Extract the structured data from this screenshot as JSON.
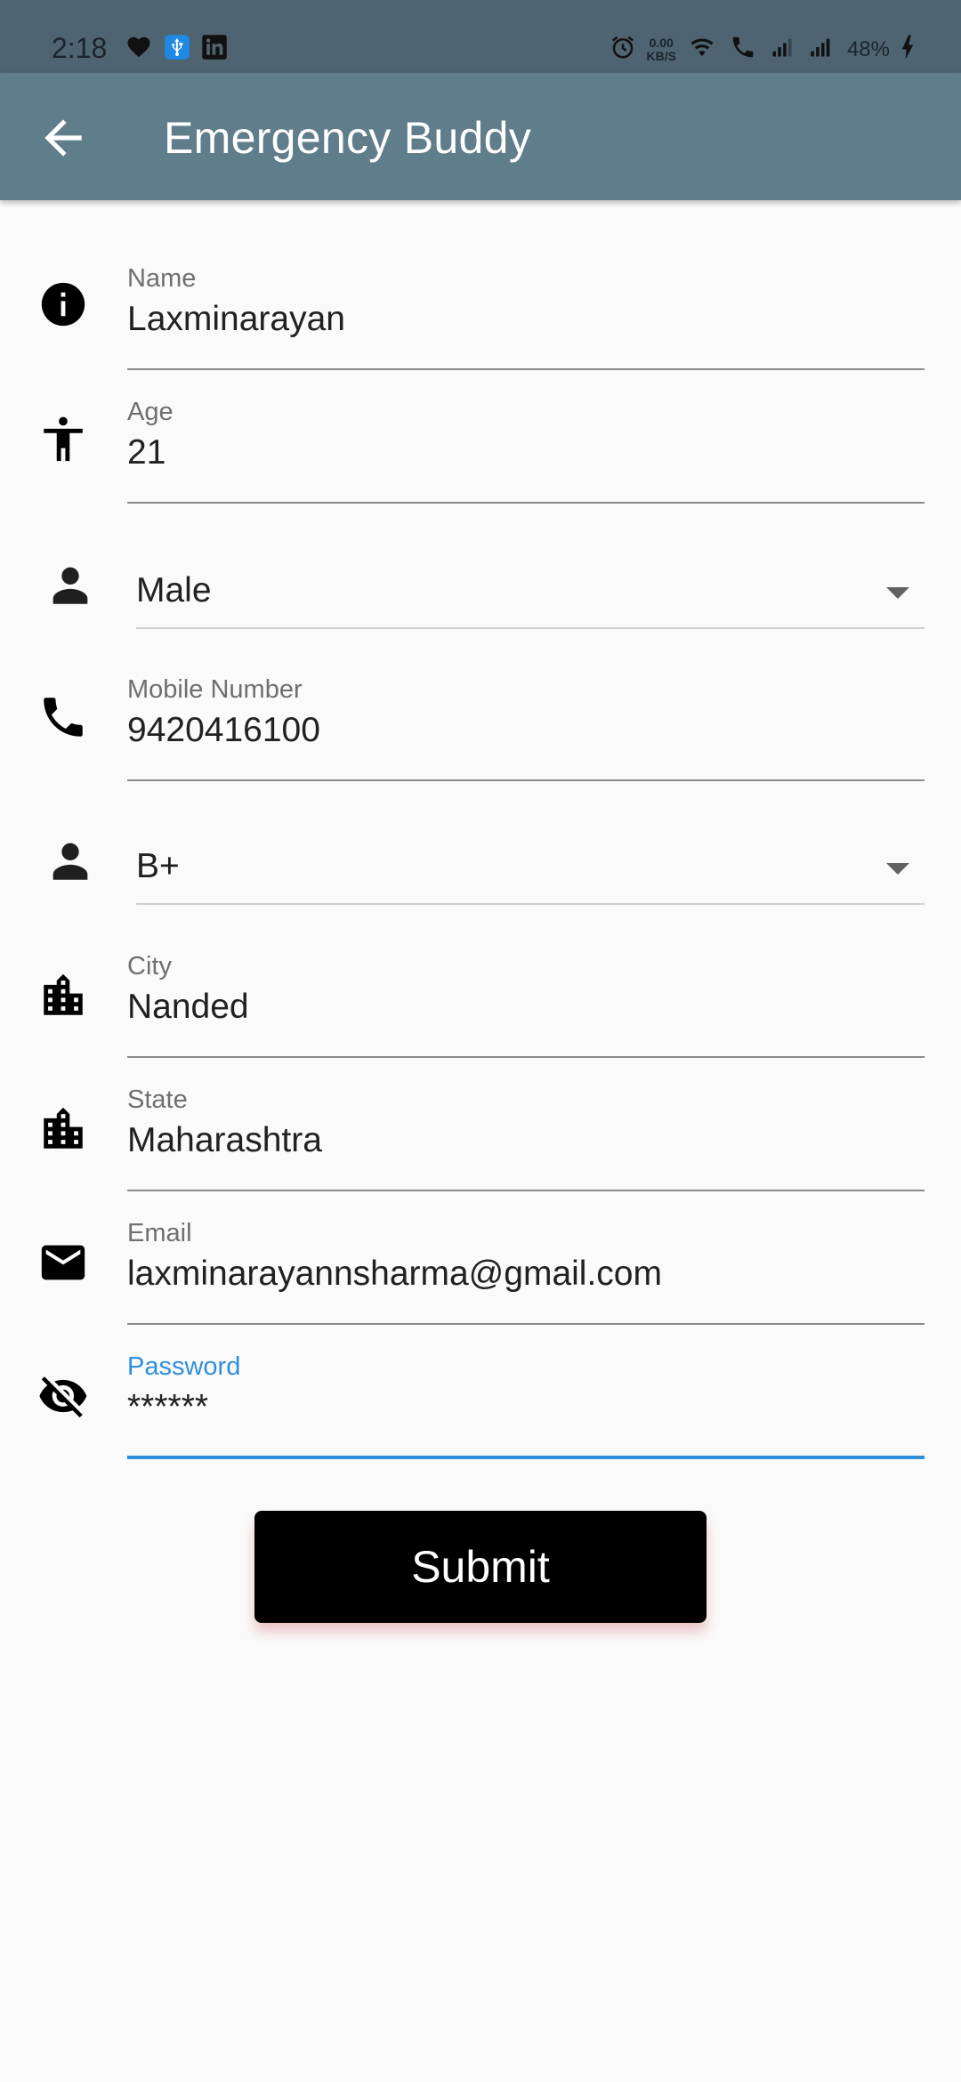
{
  "status_bar": {
    "time": "2:18",
    "net_speed_value": "0.00",
    "net_speed_unit": "KB/S",
    "battery": "48%"
  },
  "app_bar": {
    "title": "Emergency Buddy"
  },
  "form": {
    "name": {
      "label": "Name",
      "value": "Laxminarayan"
    },
    "age": {
      "label": "Age",
      "value": "21"
    },
    "gender": {
      "value": "Male"
    },
    "mobile": {
      "label": "Mobile Number",
      "value": "9420416100"
    },
    "blood_group": {
      "value": "B+"
    },
    "city": {
      "label": "City",
      "value": "Nanded"
    },
    "state": {
      "label": "State",
      "value": "Maharashtra"
    },
    "email": {
      "label": "Email",
      "value": "laxminarayannsharma@gmail.com"
    },
    "password": {
      "label": "Password",
      "value": "******"
    }
  },
  "submit_label": "Submit",
  "colors": {
    "app_bar": "#607d8b",
    "status_bar": "#4e6470",
    "focus": "#2f8fdc",
    "button": "#000000"
  }
}
